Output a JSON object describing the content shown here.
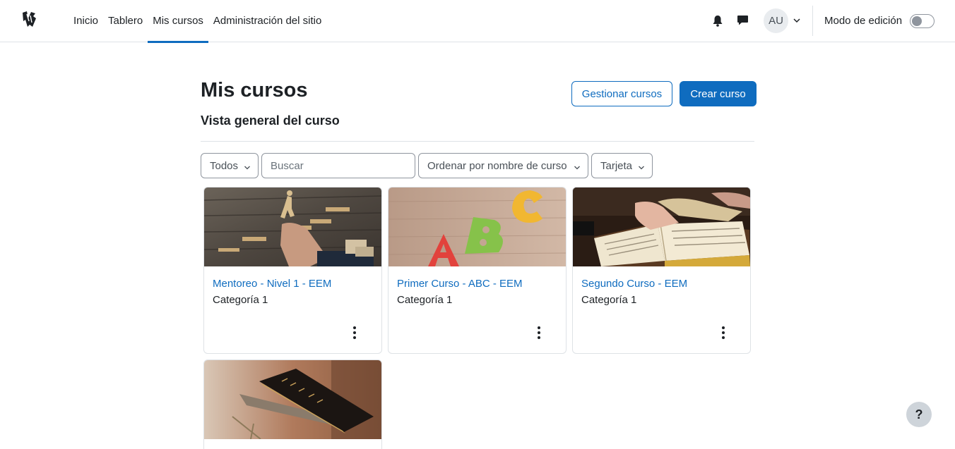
{
  "nav": {
    "links": [
      {
        "label": "Inicio",
        "active": false
      },
      {
        "label": "Tablero",
        "active": false
      },
      {
        "label": "Mis cursos",
        "active": true
      },
      {
        "label": "Administración del sitio",
        "active": false
      }
    ],
    "user_initials": "AU",
    "edit_mode_label": "Modo de edición",
    "edit_mode_on": false
  },
  "page": {
    "title": "Mis cursos",
    "subtitle": "Vista general del curso",
    "manage_button": "Gestionar cursos",
    "create_button": "Crear curso"
  },
  "filters": {
    "grouping": "Todos",
    "search_placeholder": "Buscar",
    "sort": "Ordenar por nombre de curso",
    "view": "Tarjeta"
  },
  "courses": [
    {
      "name": "Mentoreo - Nivel 1 - EEM",
      "category": "Categoría 1",
      "image": "stairs-hand-photo"
    },
    {
      "name": "Primer Curso - ABC - EEM",
      "category": "Categoría 1",
      "image": "abc-letters-photo"
    },
    {
      "name": "Segundo Curso - EEM",
      "category": "Categoría 1",
      "image": "open-bible-photo"
    },
    {
      "name": "",
      "category": "",
      "image": "holy-bible-photo"
    }
  ],
  "help": {
    "label": "?"
  },
  "colors": {
    "accent": "#0f6cbf",
    "text": "#1d2125",
    "border": "#dee2e6"
  }
}
